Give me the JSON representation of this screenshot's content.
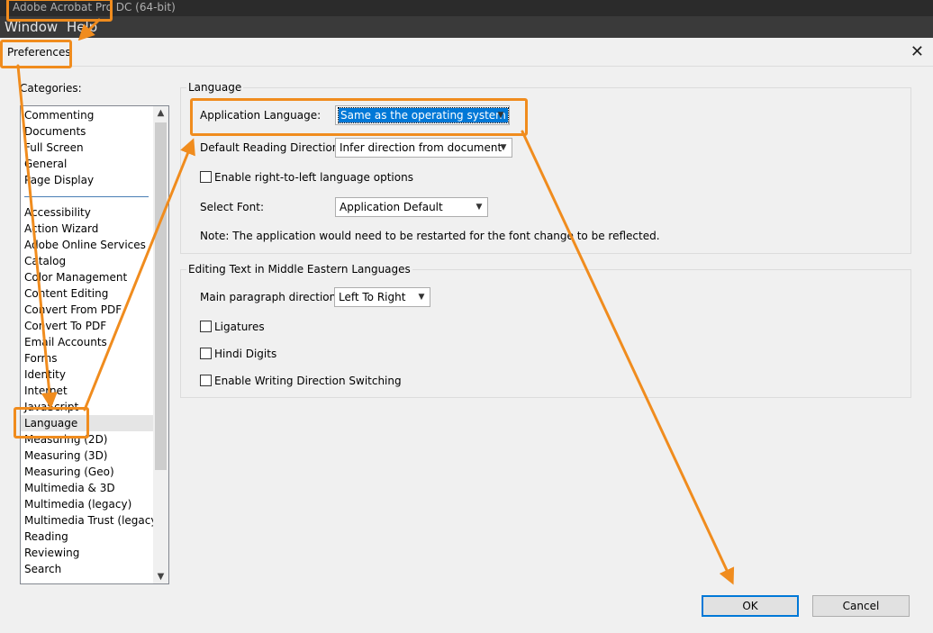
{
  "app": {
    "title": "Adobe Acrobat Pro DC (64-bit)"
  },
  "menubar": {
    "items": [
      "Window",
      "Help"
    ]
  },
  "dialog": {
    "title": "Preferences"
  },
  "categories": {
    "label": "Categories:",
    "top_items": [
      "Commenting",
      "Documents",
      "Full Screen",
      "General",
      "Page Display"
    ],
    "items": [
      "Accessibility",
      "Action Wizard",
      "Adobe Online Services",
      "Catalog",
      "Color Management",
      "Content Editing",
      "Convert From PDF",
      "Convert To PDF",
      "Email Accounts",
      "Forms",
      "Identity",
      "Internet",
      "JavaScript",
      "Language",
      "Measuring (2D)",
      "Measuring (3D)",
      "Measuring (Geo)",
      "Multimedia & 3D",
      "Multimedia (legacy)",
      "Multimedia Trust (legacy)",
      "Reading",
      "Reviewing",
      "Search"
    ],
    "selected": "Language"
  },
  "language_group": {
    "title": "Language",
    "app_language_label": "Application Language:",
    "app_language_value": "Same as the operating system",
    "reading_direction_label": "Default Reading Direction:",
    "reading_direction_value": "Infer direction from document",
    "rtl_label": "Enable right-to-left language options",
    "font_label": "Select Font:",
    "font_value": "Application Default",
    "note": "Note: The application would need to be restarted for the font change to be reflected."
  },
  "middle_east_group": {
    "title": "Editing Text in Middle Eastern Languages",
    "para_direction_label": "Main paragraph direction:",
    "para_direction_value": "Left To Right",
    "ligatures_label": "Ligatures",
    "hindi_digits_label": "Hindi Digits",
    "writing_direction_label": "Enable Writing Direction Switching"
  },
  "buttons": {
    "ok": "OK",
    "cancel": "Cancel"
  },
  "colors": {
    "annotation": "#f08c1e",
    "selection": "#0078d7"
  }
}
